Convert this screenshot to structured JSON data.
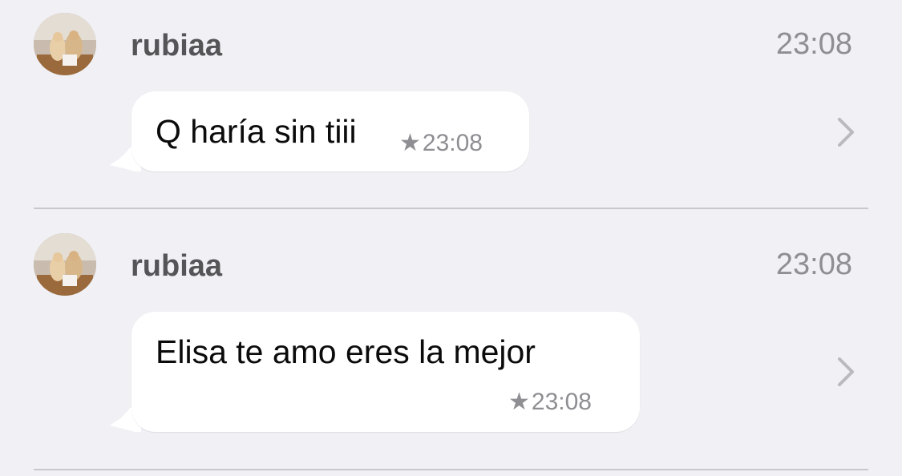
{
  "messages": [
    {
      "sender": "rubiaa",
      "time": "23:08",
      "text": "Q haría sin tiii",
      "bubble_time": "23:08",
      "star_icon": "star-icon",
      "chevron_icon": "chevron-right-icon"
    },
    {
      "sender": "rubiaa",
      "time": "23:08",
      "text": "Elisa te amo eres la mejor",
      "bubble_time": "23:08",
      "star_icon": "star-icon",
      "chevron_icon": "chevron-right-icon"
    }
  ],
  "colors": {
    "background": "#f0f0f5",
    "bubble": "#ffffff",
    "secondary_text": "#8e8e93",
    "sender_text": "#555558",
    "divider": "#c8c8cd"
  }
}
